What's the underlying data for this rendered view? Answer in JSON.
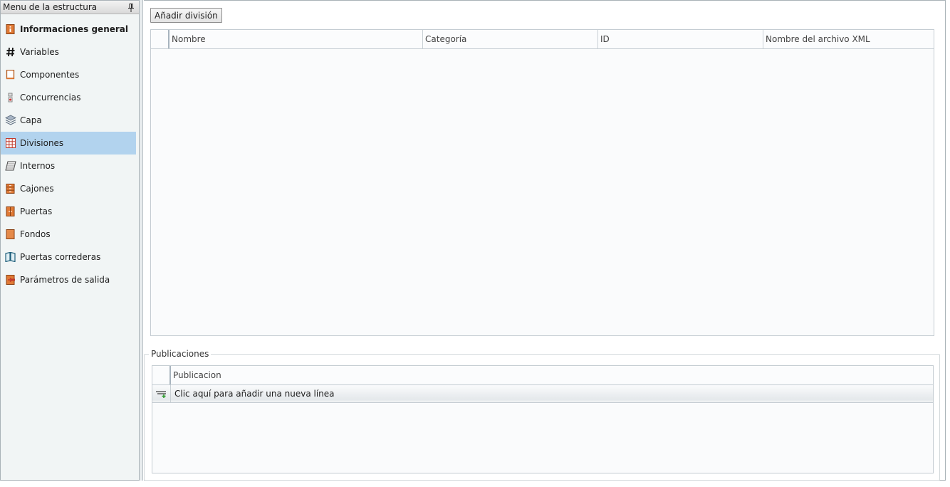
{
  "sidebar": {
    "title": "Menu de la estructura",
    "items": [
      {
        "label": "Informaciones general",
        "icon": "info-icon"
      },
      {
        "label": "Variables",
        "icon": "hash-icon"
      },
      {
        "label": "Componentes",
        "icon": "component-icon"
      },
      {
        "label": "Concurrencias",
        "icon": "concurrence-icon"
      },
      {
        "label": "Capa",
        "icon": "layers-icon"
      },
      {
        "label": "Divisiones",
        "icon": "grid-icon"
      },
      {
        "label": "Internos",
        "icon": "shelf-icon"
      },
      {
        "label": "Cajones",
        "icon": "drawer-icon"
      },
      {
        "label": "Puertas",
        "icon": "door-icon"
      },
      {
        "label": "Fondos",
        "icon": "back-panel-icon"
      },
      {
        "label": "Puertas correderas",
        "icon": "sliding-door-icon"
      },
      {
        "label": "Parámetros de salida",
        "icon": "export-icon"
      }
    ],
    "selected_label": "Divisiones"
  },
  "toolbar": {
    "add_division_label": "Añadir división"
  },
  "divisions_grid": {
    "columns": [
      "Nombre",
      "Categoría",
      "ID",
      "Nombre del archivo XML"
    ],
    "rows": []
  },
  "publicaciones": {
    "title": "Publicaciones",
    "columns": [
      "Publicacion"
    ],
    "new_row_label": "Clic aquí para añadir una nueva línea"
  },
  "colors": {
    "selected_background": "#b2d3ee",
    "sidebar_background": "#f1f5f5",
    "icon_orange": "#e07a35"
  }
}
